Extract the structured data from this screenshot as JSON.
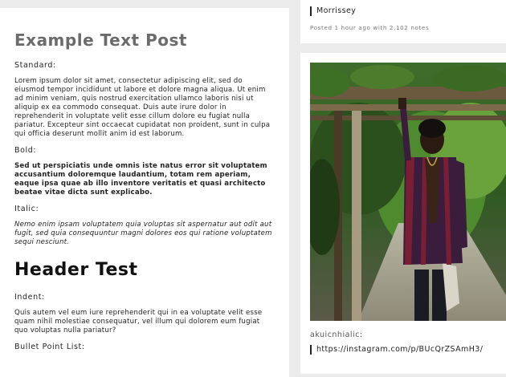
{
  "left_post": {
    "title": "Example Text Post",
    "standard_label": "Standard:",
    "standard_text": "Lorem ipsum dolor sit amet, consectetur adipiscing elit, sed do eiusmod tempor incididunt ut labore et dolore magna aliqua. Ut enim ad minim veniam, quis nostrud exercitation ullamco laboris nisi ut aliquip ex ea commodo consequat. Duis aute irure dolor in reprehenderit in voluptate velit esse cillum dolore eu fugiat nulla pariatur. Excepteur sint occaecat cupidatat non proident, sunt in culpa qui officia deserunt mollit anim id est laborum.",
    "bold_label": "Bold:",
    "bold_text": "Sed ut perspiciatis unde omnis iste natus error sit voluptatem accusantium doloremque laudantium, totam rem aperiam, eaque ipsa quae ab illo inventore veritatis et quasi architecto beatae vitae dicta sunt explicabo.",
    "italic_label": "Italic:",
    "italic_text": "Nemo enim ipsam voluptatem quia voluptas sit aspernatur aut odit aut fugit, sed quia consequuntur magni dolores eos qui ratione voluptatem sequi nesciunt.",
    "header": "Header Test",
    "indent_label": "Indent:",
    "indent_text": "Quis autem vel eum iure reprehenderit qui in ea voluptate velit esse quam nihil molestiae consequatur, vel illum qui dolorem eum fugiat quo voluptas nulla pariatur?",
    "bullet_label": "Bullet Point List:"
  },
  "right_top_post": {
    "source": "Morrissey",
    "meta": "Posted 1 hour ago with 2,102 notes"
  },
  "right_photo_post": {
    "caption_user": "akuicnhialic:",
    "caption_link": "https://instagram.com/p/BUcQrZSAmH3/"
  },
  "colors": {
    "page_bg": "#ebebeb",
    "card_bg": "#ffffff",
    "title_gray": "#6b6b6b"
  }
}
